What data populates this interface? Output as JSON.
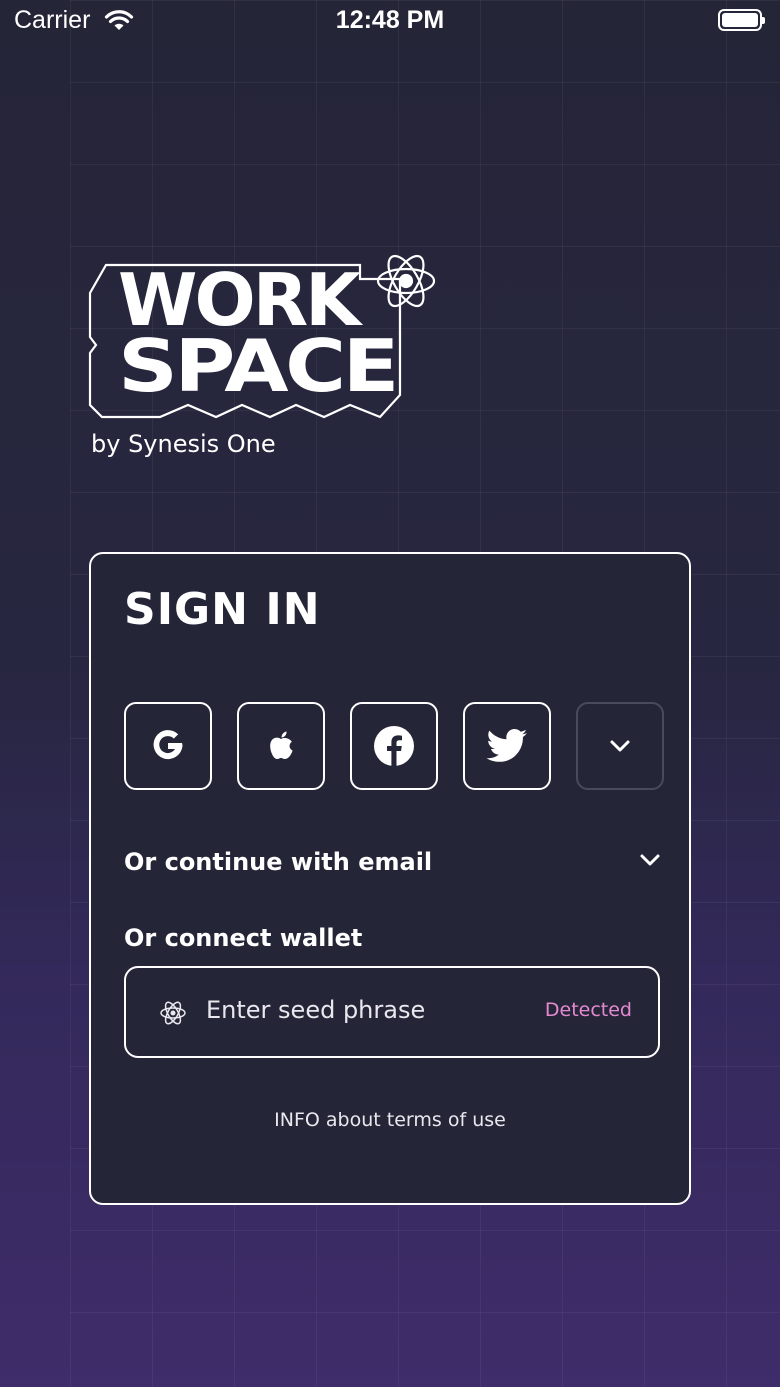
{
  "status_bar": {
    "carrier": "Carrier",
    "time": "12:48 PM"
  },
  "branding": {
    "logo_line1": "WORK",
    "logo_line2": "SPACE",
    "byline": "by Synesis One"
  },
  "signin": {
    "title": "SIGN IN",
    "social_buttons": [
      {
        "name": "google",
        "icon": "google-icon"
      },
      {
        "name": "apple",
        "icon": "apple-icon"
      },
      {
        "name": "facebook",
        "icon": "facebook-icon"
      },
      {
        "name": "twitter",
        "icon": "twitter-icon"
      },
      {
        "name": "more",
        "icon": "chevron-down-icon"
      }
    ],
    "email_label": "Or continue with email",
    "wallet_label": "Or connect wallet",
    "seed_input": {
      "placeholder": "Enter seed phrase",
      "status": "Detected"
    },
    "terms": "INFO about terms of use"
  },
  "colors": {
    "accent_pink": "#e58ad0",
    "card_bg": "#252538",
    "border": "#ffffff"
  }
}
